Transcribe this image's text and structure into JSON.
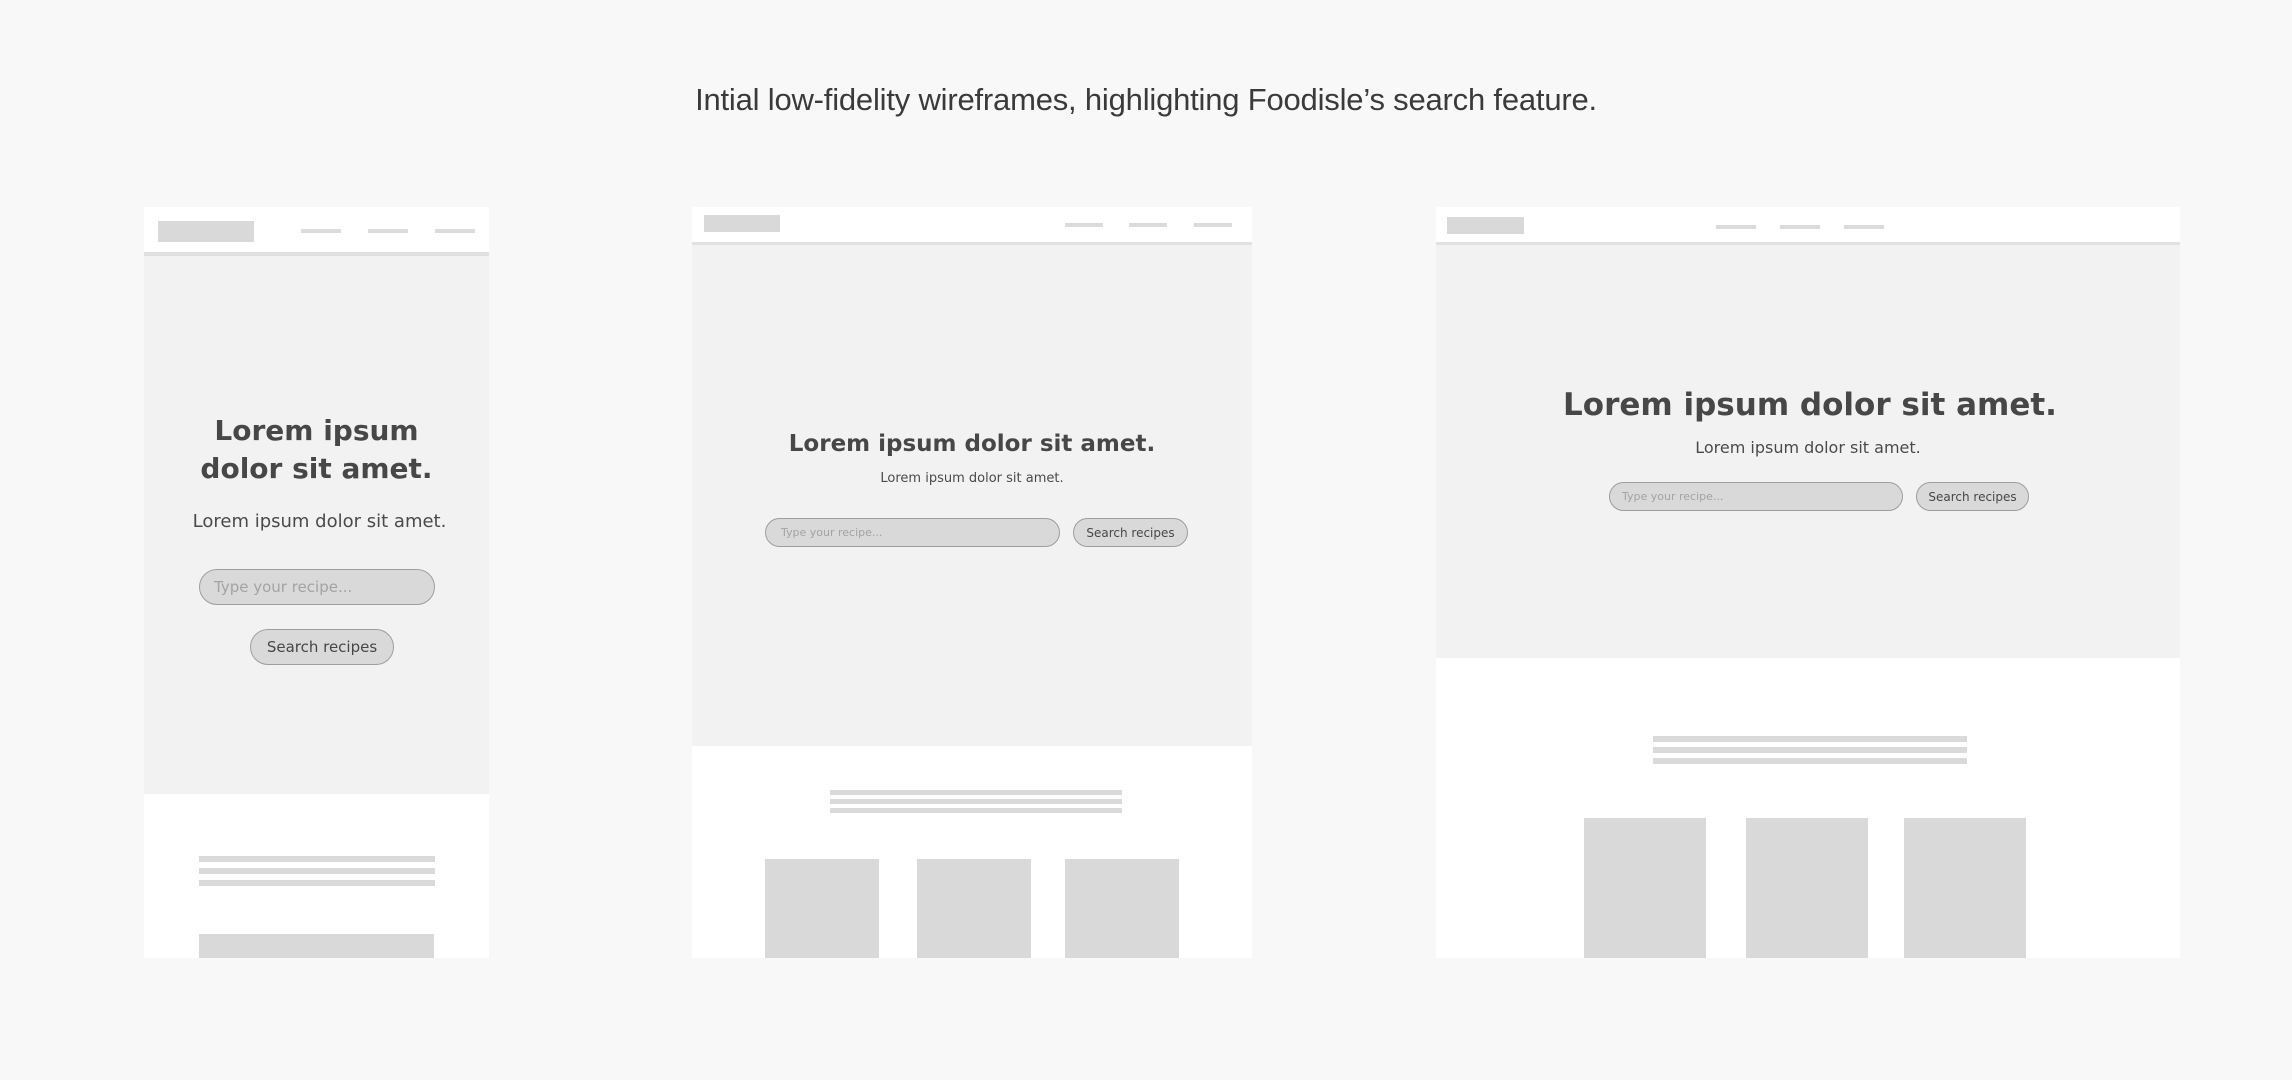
{
  "caption": "Intial low-fidelity wireframes, highlighting Foodisle’s search feature.",
  "wireframes": [
    {
      "device": "mobile",
      "hero_title": "Lorem ipsum\ndolor sit amet.",
      "hero_subtitle": "Lorem ipsum dolor sit amet.",
      "search_placeholder": "Type your recipe...",
      "search_button": "Search recipes"
    },
    {
      "device": "tablet",
      "hero_title": "Lorem ipsum dolor sit amet.",
      "hero_subtitle": "Lorem ipsum dolor sit amet.",
      "search_placeholder": "Type your recipe...",
      "search_button": "Search recipes"
    },
    {
      "device": "desktop",
      "hero_title": "Lorem ipsum dolor sit amet.",
      "hero_subtitle": "Lorem ipsum dolor sit amet.",
      "search_placeholder": "Type your recipe...",
      "search_button": "Search recipes"
    }
  ],
  "colors": {
    "page_background": "#f8f8f8",
    "frame_background": "#ffffff",
    "hero_background": "#f2f2f2",
    "placeholder_block": "#d9d9d9",
    "text": "#474747"
  }
}
